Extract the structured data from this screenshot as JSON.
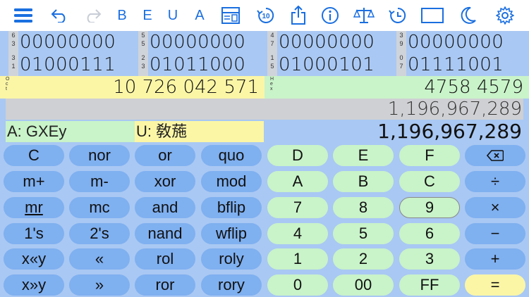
{
  "toolbar": {
    "letters": [
      "B",
      "E",
      "U",
      "A"
    ]
  },
  "bits": {
    "row1": [
      {
        "idx": [
          "6",
          "3"
        ],
        "bits": "00000000"
      },
      {
        "idx": [
          "5",
          "5"
        ],
        "bits": "00000000"
      },
      {
        "idx": [
          "4",
          "7"
        ],
        "bits": "00000000"
      },
      {
        "idx": [
          "3",
          "9"
        ],
        "bits": "00000000"
      }
    ],
    "row2": [
      {
        "idx": [
          "3",
          "1"
        ],
        "bits": "01000111"
      },
      {
        "idx": [
          "2",
          "3"
        ],
        "bits": "01011000"
      },
      {
        "idx": [
          "1",
          "5"
        ],
        "bits": "01000101"
      },
      {
        "idx": [
          "0",
          "7"
        ],
        "bits": "01111001"
      }
    ]
  },
  "oct": {
    "tag": [
      "O",
      "c",
      "t"
    ],
    "value": "10 726 042 571"
  },
  "hex": {
    "tag": [
      "H",
      "e",
      "x"
    ],
    "value": "4758 4579"
  },
  "signed_decimal": "1,196,967,289",
  "ascii": "A: GXEy",
  "unicode": "U: 敎葹",
  "decimal": "1,196,967,289",
  "keys": {
    "r1": [
      "C",
      "nor",
      "or",
      "quo",
      "D",
      "E",
      "F"
    ],
    "r2": [
      "m+",
      "m-",
      "xor",
      "mod",
      "A",
      "B",
      "C",
      "÷"
    ],
    "r3": [
      "mr",
      "mc",
      "and",
      "bflip",
      "7",
      "8",
      "9",
      "×"
    ],
    "r4": [
      "1's",
      "2's",
      "nand",
      "wflip",
      "4",
      "5",
      "6",
      "−"
    ],
    "r5": [
      "x«y",
      "«",
      "rol",
      "roly",
      "1",
      "2",
      "3",
      "+"
    ],
    "r6": [
      "x»y",
      "»",
      "ror",
      "rory",
      "0",
      "00",
      "FF",
      "="
    ]
  },
  "colors": {
    "accent": "#1a6fe0",
    "bg": "#a9c8f3",
    "yellow": "#fbf6a6",
    "green": "#c9f3c9",
    "key_blue": "#7fb0f0"
  }
}
